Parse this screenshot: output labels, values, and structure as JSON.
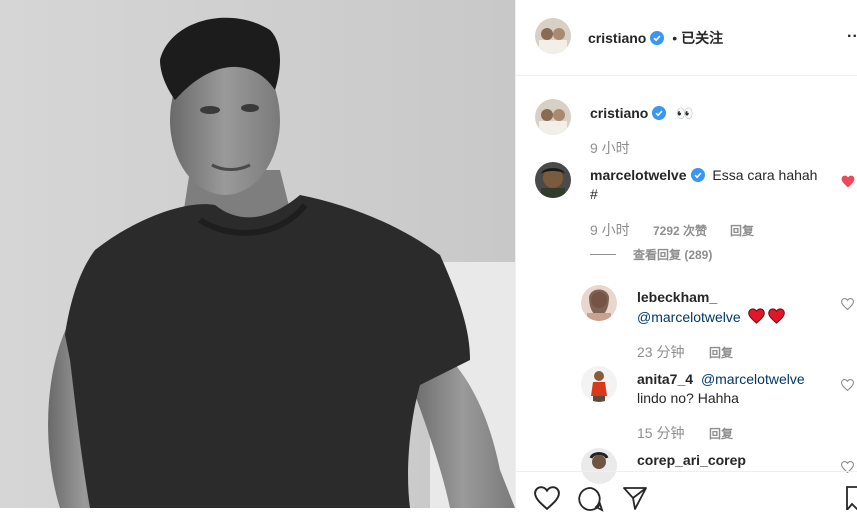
{
  "header": {
    "username": "cristiano",
    "follow_sep": "•",
    "follow_status": "已关注",
    "more": "..."
  },
  "caption": {
    "username": "cristiano",
    "text": "👀",
    "time": "9 小时"
  },
  "comment": {
    "username": "marcelotwelve",
    "text_line1": "Essa cara hahah",
    "text_line2": "#",
    "time": "9 小时",
    "likes": "7292 次赞",
    "reply": "回复",
    "view_replies": "查看回复 (289)"
  },
  "replies": [
    {
      "username": "lebeckham_",
      "mention": "@marcelotwelve",
      "text": "",
      "time": "23 分钟",
      "reply": "回复"
    },
    {
      "username": "anita7_4",
      "mention": "@marcelotwelve",
      "text": "lindo no? Hahha",
      "time": "15 分钟",
      "reply": "回复"
    },
    {
      "username": "corep_ari_corep",
      "mention": "",
      "text": "",
      "time": "",
      "reply": ""
    }
  ],
  "icons": {
    "verified_color": "#3897f0",
    "liked_color": "#ed4956"
  }
}
